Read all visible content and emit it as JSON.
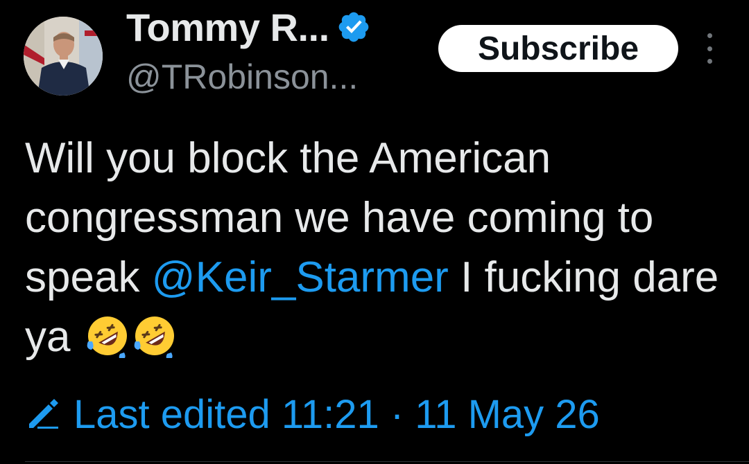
{
  "author": {
    "display_name": "Tommy R...",
    "handle": "@TRobinson...",
    "verified_color": "#1d9bf0"
  },
  "header": {
    "subscribe_label": "Subscribe",
    "more_icon": "more-vertical-icon"
  },
  "tweet": {
    "text_part1": "Will you block the American congressman we have coming to speak ",
    "mention": "@Keir_Starmer",
    "text_part2": " I fucking dare ya",
    "emojis": [
      "rolling-on-floor-laughing",
      "rolling-on-floor-laughing"
    ]
  },
  "edited": {
    "label": "Last edited 11:21 · 11 May 26",
    "icon": "pencil-icon"
  },
  "colors": {
    "background": "#000000",
    "text": "#e7e9ea",
    "secondary": "#8b9299",
    "accent": "#1d9bf0"
  }
}
